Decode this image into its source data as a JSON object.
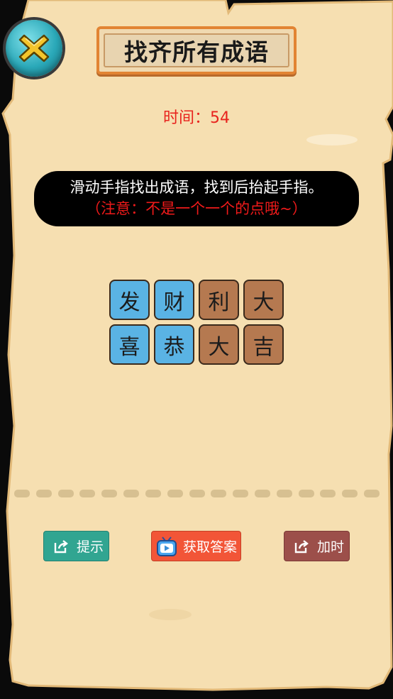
{
  "header": {
    "title": "找齐所有成语",
    "close_icon": "close-x-icon"
  },
  "timer": {
    "text": "时间：54"
  },
  "instructions": {
    "line1": "滑动手指找出成语，找到后抬起手指。",
    "line2": "（注意：不是一个一个的点哦~）"
  },
  "board": {
    "tiles": [
      {
        "char": "发",
        "color": "blue"
      },
      {
        "char": "财",
        "color": "blue"
      },
      {
        "char": "利",
        "color": "brown"
      },
      {
        "char": "大",
        "color": "brown"
      },
      {
        "char": "喜",
        "color": "blue"
      },
      {
        "char": "恭",
        "color": "blue"
      },
      {
        "char": "大",
        "color": "brown"
      },
      {
        "char": "吉",
        "color": "brown"
      }
    ],
    "colors": {
      "blue": "#5ab3e4",
      "brown": "#b57950"
    }
  },
  "buttons": {
    "hint": {
      "label": "提示",
      "icon": "share-icon",
      "color": "#31a591"
    },
    "answer": {
      "label": "获取答案",
      "icon": "video-tv-icon",
      "color": "#f25537"
    },
    "add_time": {
      "label": "加时",
      "icon": "share-icon",
      "color": "#9c4f4a"
    }
  }
}
